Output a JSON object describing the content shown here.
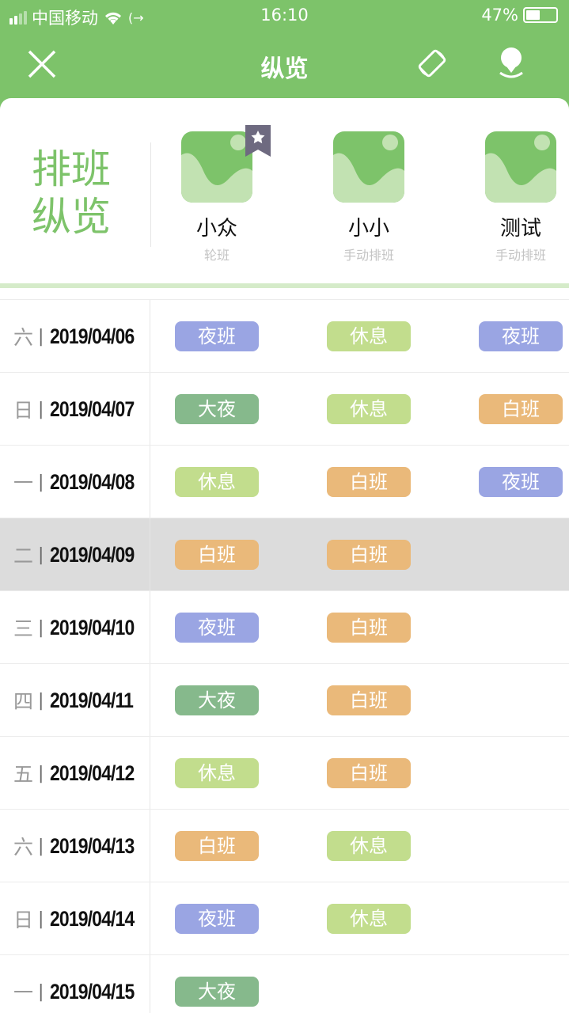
{
  "status": {
    "carrier": "中国移动",
    "time": "16:10",
    "battery": "47%",
    "battery_level": 0.47
  },
  "nav": {
    "title": "纵览"
  },
  "header": {
    "title_line1": "排班",
    "title_line2": "纵览"
  },
  "people": [
    {
      "name": "小众",
      "type": "轮班",
      "starred": true
    },
    {
      "name": "小小",
      "type": "手动排班",
      "starred": false
    },
    {
      "name": "测试",
      "type": "手动排班",
      "starred": false
    }
  ],
  "colors": {
    "green": "#7dc36a",
    "夜班": "#9aa5e3",
    "休息": "#c2dd8d",
    "大夜": "#86b98c",
    "白班": "#eab97a"
  },
  "rows": [
    {
      "weekday": "六",
      "date": "2019/04/06",
      "shifts": [
        "夜班",
        "休息",
        "夜班"
      ]
    },
    {
      "weekday": "日",
      "date": "2019/04/07",
      "shifts": [
        "大夜",
        "休息",
        "白班"
      ]
    },
    {
      "weekday": "一",
      "date": "2019/04/08",
      "shifts": [
        "休息",
        "白班",
        "夜班"
      ]
    },
    {
      "weekday": "二",
      "date": "2019/04/09",
      "shifts": [
        "白班",
        "白班",
        ""
      ],
      "selected": true
    },
    {
      "weekday": "三",
      "date": "2019/04/10",
      "shifts": [
        "夜班",
        "白班",
        ""
      ]
    },
    {
      "weekday": "四",
      "date": "2019/04/11",
      "shifts": [
        "大夜",
        "白班",
        ""
      ]
    },
    {
      "weekday": "五",
      "date": "2019/04/12",
      "shifts": [
        "休息",
        "白班",
        ""
      ]
    },
    {
      "weekday": "六",
      "date": "2019/04/13",
      "shifts": [
        "白班",
        "休息",
        ""
      ]
    },
    {
      "weekday": "日",
      "date": "2019/04/14",
      "shifts": [
        "夜班",
        "休息",
        ""
      ]
    },
    {
      "weekday": "一",
      "date": "2019/04/15",
      "shifts": [
        "大夜",
        "",
        ""
      ]
    }
  ]
}
